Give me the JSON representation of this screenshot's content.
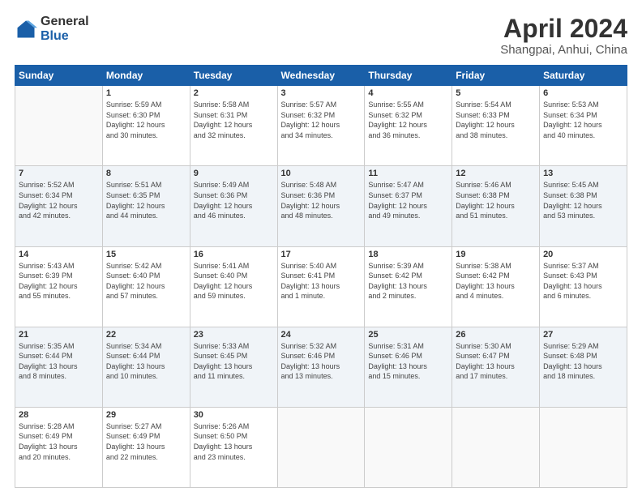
{
  "logo": {
    "general": "General",
    "blue": "Blue"
  },
  "header": {
    "month": "April 2024",
    "location": "Shangpai, Anhui, China"
  },
  "weekdays": [
    "Sunday",
    "Monday",
    "Tuesday",
    "Wednesday",
    "Thursday",
    "Friday",
    "Saturday"
  ],
  "weeks": [
    [
      {
        "day": "",
        "info": ""
      },
      {
        "day": "1",
        "info": "Sunrise: 5:59 AM\nSunset: 6:30 PM\nDaylight: 12 hours\nand 30 minutes."
      },
      {
        "day": "2",
        "info": "Sunrise: 5:58 AM\nSunset: 6:31 PM\nDaylight: 12 hours\nand 32 minutes."
      },
      {
        "day": "3",
        "info": "Sunrise: 5:57 AM\nSunset: 6:32 PM\nDaylight: 12 hours\nand 34 minutes."
      },
      {
        "day": "4",
        "info": "Sunrise: 5:55 AM\nSunset: 6:32 PM\nDaylight: 12 hours\nand 36 minutes."
      },
      {
        "day": "5",
        "info": "Sunrise: 5:54 AM\nSunset: 6:33 PM\nDaylight: 12 hours\nand 38 minutes."
      },
      {
        "day": "6",
        "info": "Sunrise: 5:53 AM\nSunset: 6:34 PM\nDaylight: 12 hours\nand 40 minutes."
      }
    ],
    [
      {
        "day": "7",
        "info": "Sunrise: 5:52 AM\nSunset: 6:34 PM\nDaylight: 12 hours\nand 42 minutes."
      },
      {
        "day": "8",
        "info": "Sunrise: 5:51 AM\nSunset: 6:35 PM\nDaylight: 12 hours\nand 44 minutes."
      },
      {
        "day": "9",
        "info": "Sunrise: 5:49 AM\nSunset: 6:36 PM\nDaylight: 12 hours\nand 46 minutes."
      },
      {
        "day": "10",
        "info": "Sunrise: 5:48 AM\nSunset: 6:36 PM\nDaylight: 12 hours\nand 48 minutes."
      },
      {
        "day": "11",
        "info": "Sunrise: 5:47 AM\nSunset: 6:37 PM\nDaylight: 12 hours\nand 49 minutes."
      },
      {
        "day": "12",
        "info": "Sunrise: 5:46 AM\nSunset: 6:38 PM\nDaylight: 12 hours\nand 51 minutes."
      },
      {
        "day": "13",
        "info": "Sunrise: 5:45 AM\nSunset: 6:38 PM\nDaylight: 12 hours\nand 53 minutes."
      }
    ],
    [
      {
        "day": "14",
        "info": "Sunrise: 5:43 AM\nSunset: 6:39 PM\nDaylight: 12 hours\nand 55 minutes."
      },
      {
        "day": "15",
        "info": "Sunrise: 5:42 AM\nSunset: 6:40 PM\nDaylight: 12 hours\nand 57 minutes."
      },
      {
        "day": "16",
        "info": "Sunrise: 5:41 AM\nSunset: 6:40 PM\nDaylight: 12 hours\nand 59 minutes."
      },
      {
        "day": "17",
        "info": "Sunrise: 5:40 AM\nSunset: 6:41 PM\nDaylight: 13 hours\nand 1 minute."
      },
      {
        "day": "18",
        "info": "Sunrise: 5:39 AM\nSunset: 6:42 PM\nDaylight: 13 hours\nand 2 minutes."
      },
      {
        "day": "19",
        "info": "Sunrise: 5:38 AM\nSunset: 6:42 PM\nDaylight: 13 hours\nand 4 minutes."
      },
      {
        "day": "20",
        "info": "Sunrise: 5:37 AM\nSunset: 6:43 PM\nDaylight: 13 hours\nand 6 minutes."
      }
    ],
    [
      {
        "day": "21",
        "info": "Sunrise: 5:35 AM\nSunset: 6:44 PM\nDaylight: 13 hours\nand 8 minutes."
      },
      {
        "day": "22",
        "info": "Sunrise: 5:34 AM\nSunset: 6:44 PM\nDaylight: 13 hours\nand 10 minutes."
      },
      {
        "day": "23",
        "info": "Sunrise: 5:33 AM\nSunset: 6:45 PM\nDaylight: 13 hours\nand 11 minutes."
      },
      {
        "day": "24",
        "info": "Sunrise: 5:32 AM\nSunset: 6:46 PM\nDaylight: 13 hours\nand 13 minutes."
      },
      {
        "day": "25",
        "info": "Sunrise: 5:31 AM\nSunset: 6:46 PM\nDaylight: 13 hours\nand 15 minutes."
      },
      {
        "day": "26",
        "info": "Sunrise: 5:30 AM\nSunset: 6:47 PM\nDaylight: 13 hours\nand 17 minutes."
      },
      {
        "day": "27",
        "info": "Sunrise: 5:29 AM\nSunset: 6:48 PM\nDaylight: 13 hours\nand 18 minutes."
      }
    ],
    [
      {
        "day": "28",
        "info": "Sunrise: 5:28 AM\nSunset: 6:49 PM\nDaylight: 13 hours\nand 20 minutes."
      },
      {
        "day": "29",
        "info": "Sunrise: 5:27 AM\nSunset: 6:49 PM\nDaylight: 13 hours\nand 22 minutes."
      },
      {
        "day": "30",
        "info": "Sunrise: 5:26 AM\nSunset: 6:50 PM\nDaylight: 13 hours\nand 23 minutes."
      },
      {
        "day": "",
        "info": ""
      },
      {
        "day": "",
        "info": ""
      },
      {
        "day": "",
        "info": ""
      },
      {
        "day": "",
        "info": ""
      }
    ]
  ]
}
